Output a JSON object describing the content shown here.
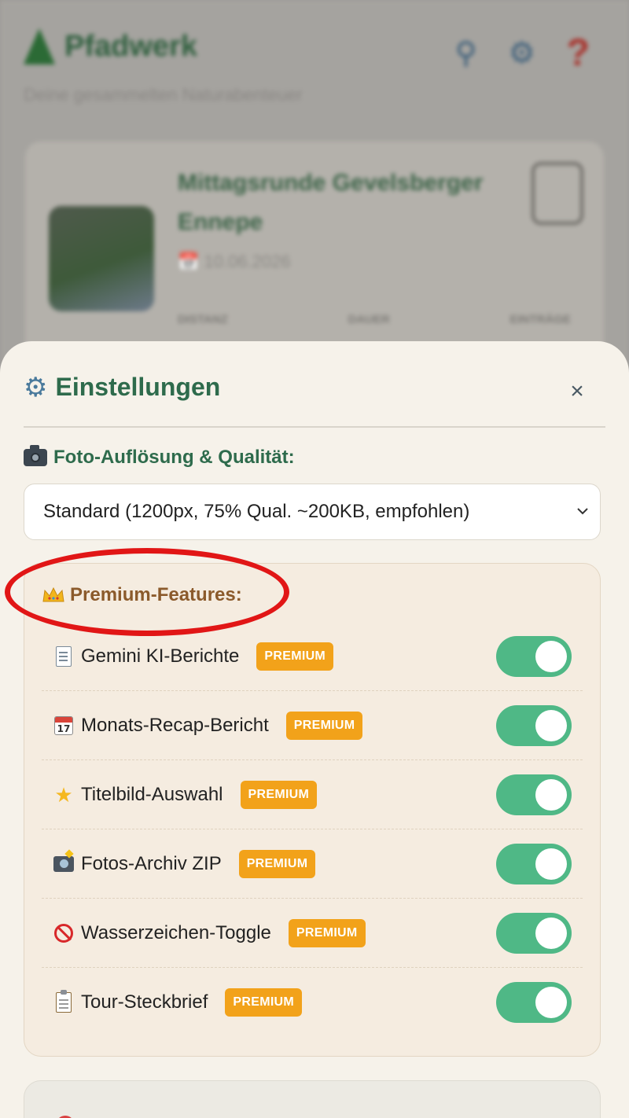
{
  "app": {
    "title": "Pfadwerk",
    "subtitle": "Deine gesammelten Naturabenteuer",
    "header_icons": [
      "search-icon",
      "gear-icon",
      "help-icon"
    ]
  },
  "background_card": {
    "title": "Mittagsrunde Gevelsberger Ennepe",
    "date": "10.06.2026",
    "stats": [
      "DISTANZ",
      "DAUER",
      "EINTRÄGE"
    ]
  },
  "settings": {
    "title": "Einstellungen",
    "close_label": "×",
    "photo_section_label": "Foto-Auflösung & Qualität:",
    "photo_quality_selected": "Standard (1200px, 75% Qual. ~200KB, empfohlen)",
    "premium_section_label": "Premium-Features:",
    "premium_badge": "PREMIUM",
    "features": [
      {
        "icon": "document-icon",
        "label": "Gemini KI-Berichte",
        "enabled": true
      },
      {
        "icon": "calendar-icon",
        "label": "Monats-Recap-Bericht",
        "enabled": true
      },
      {
        "icon": "star-icon",
        "label": "Titelbild-Auswahl",
        "enabled": true
      },
      {
        "icon": "camera-flash-icon",
        "label": "Fotos-Archiv ZIP",
        "enabled": true
      },
      {
        "icon": "no-entry-icon",
        "label": "Wasserzeichen-Toggle",
        "enabled": true
      },
      {
        "icon": "clipboard-icon",
        "label": "Tour-Steckbrief",
        "enabled": true
      }
    ]
  },
  "colors": {
    "accent_green": "#2e6b4c",
    "toggle_on": "#4fb886",
    "premium_badge": "#f2a21a",
    "premium_label": "#8b5a2b",
    "highlight": "#e11616"
  }
}
